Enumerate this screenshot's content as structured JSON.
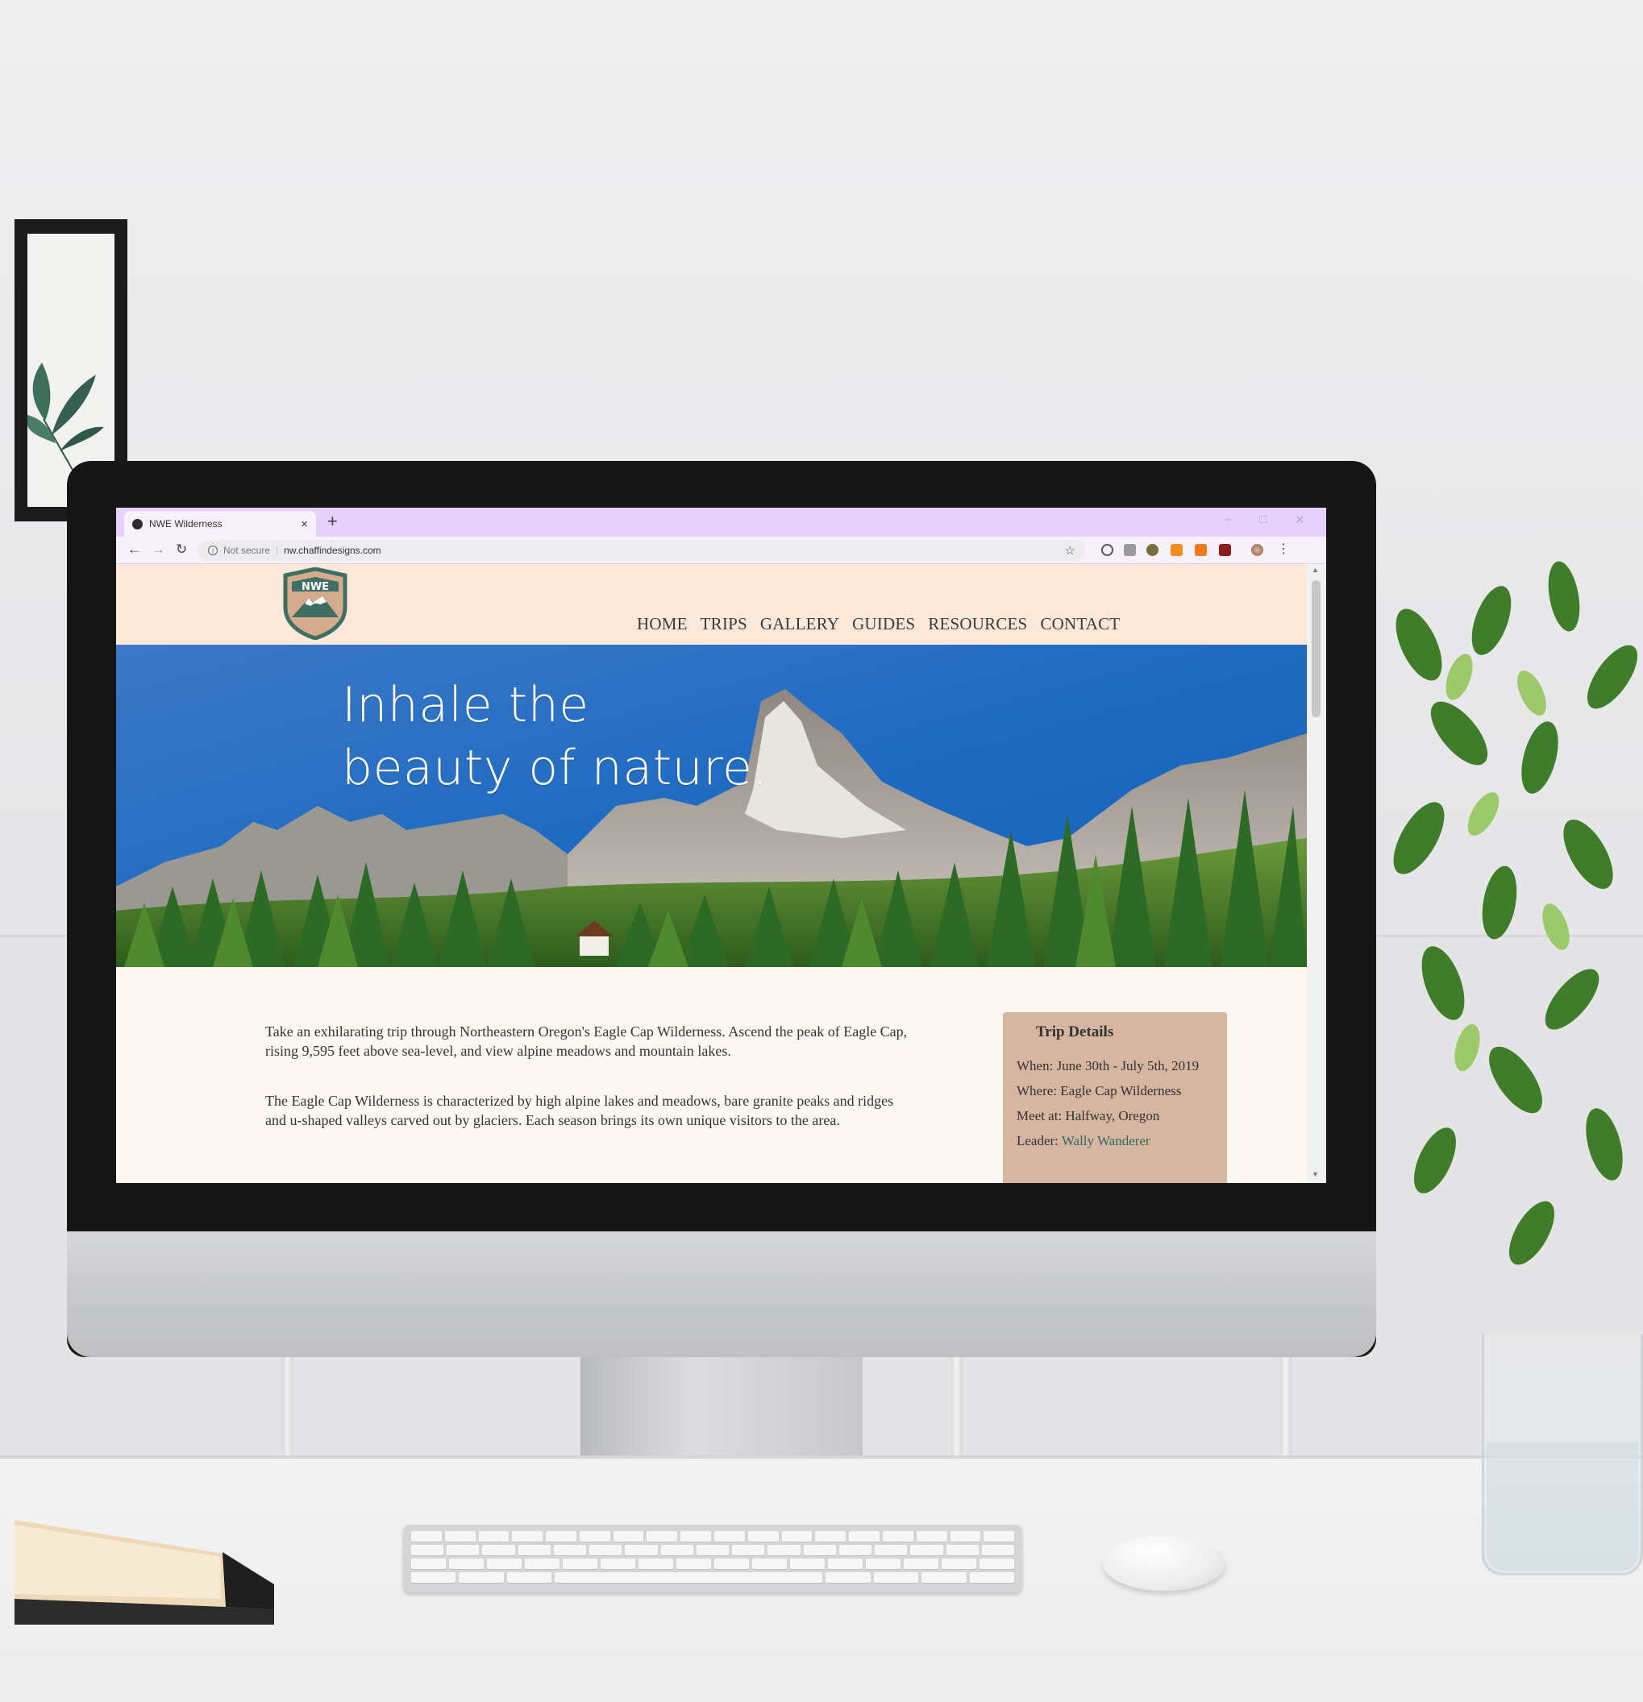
{
  "browser": {
    "tab_title": "NWE Wilderness",
    "tab_close": "×",
    "new_tab": "+",
    "omnibox_security": "Not secure",
    "omnibox_separator": "|",
    "url": "nw.chaffindesigns.com"
  },
  "site": {
    "logo_text": "NWE",
    "nav": [
      "HOME",
      "TRIPS",
      "GALLERY",
      "GUIDES",
      "RESOURCES",
      "CONTACT"
    ],
    "hero": {
      "line1": "Inhale the",
      "line2": "beauty of nature."
    },
    "paragraphs": [
      "Take an exhilarating trip through Northeastern Oregon's Eagle Cap Wilderness. Ascend the peak of Eagle Cap, rising 9,595 feet above sea-level, and view alpine meadows and mountain lakes.",
      "The Eagle Cap Wilderness is characterized by high alpine lakes and meadows, bare granite peaks and ridges and u-shaped valleys carved out by glaciers. Each season brings its own unique visitors to the area."
    ],
    "trip_details": {
      "title": "Trip Details",
      "when": "When: June 30th - July 5th, 2019",
      "where": "Where: Eagle Cap Wilderness",
      "meet": "Meet at: Halfway, Oregon",
      "leader_label": "Leader: ",
      "leader_name": "Wally Wanderer"
    }
  },
  "colors": {
    "tabbar": "#e5d1fa",
    "header_bg": "#fbe8d9",
    "content_bg": "#fdf7f1",
    "card_bg": "#d6b5a1",
    "link": "#2f6c5f"
  }
}
